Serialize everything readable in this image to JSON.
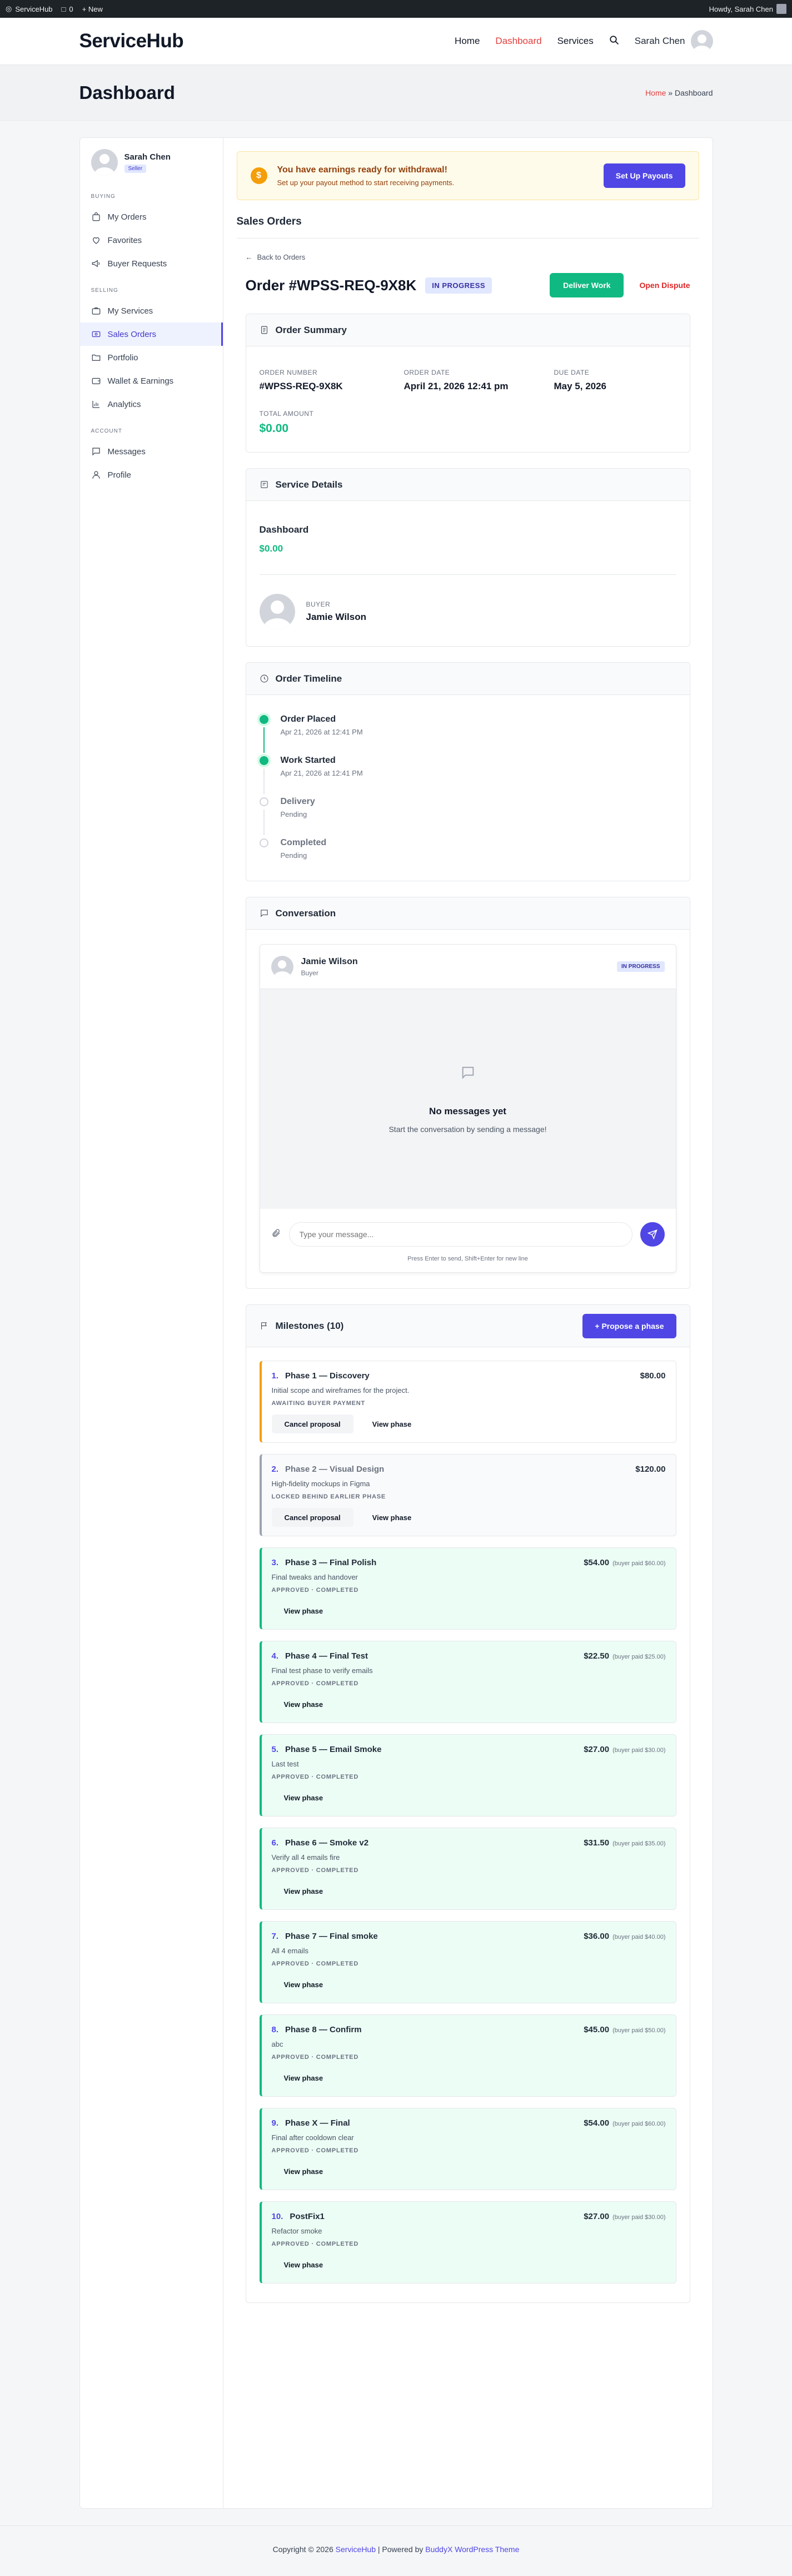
{
  "adminbar": {
    "site": "ServiceHub",
    "comments": "0",
    "new": "+ New",
    "howdy": "Howdy, Sarah Chen"
  },
  "header": {
    "logo": "ServiceHub",
    "nav": [
      "Home",
      "Dashboard",
      "Services"
    ],
    "user": "Sarah Chen"
  },
  "title_band": {
    "title": "Dashboard",
    "crumb_home": "Home",
    "crumb_sep": " » ",
    "crumb_current": "Dashboard"
  },
  "sidebar": {
    "name": "Sarah Chen",
    "role": "Seller",
    "buying_label": "BUYING",
    "buying": [
      "My Orders",
      "Favorites",
      "Buyer Requests"
    ],
    "selling_label": "SELLING",
    "selling": [
      "My Services",
      "Sales Orders",
      "Portfolio",
      "Wallet & Earnings",
      "Analytics"
    ],
    "account_label": "ACCOUNT",
    "account": [
      "Messages",
      "Profile"
    ]
  },
  "payout": {
    "title": "You have earnings ready for withdrawal!",
    "subtitle": "Set up your payout method to start receiving payments.",
    "button": "Set Up Payouts"
  },
  "section_title": "Sales Orders",
  "order": {
    "back": "Back to Orders",
    "number_title": "Order #WPSS-REQ-9X8K",
    "status": "IN PROGRESS",
    "deliver": "Deliver Work",
    "dispute": "Open Dispute"
  },
  "summary": {
    "title": "Order Summary",
    "order_number_label": "ORDER NUMBER",
    "order_number": "#WPSS-REQ-9X8K",
    "order_date_label": "ORDER DATE",
    "order_date": "April 21, 2026 12:41 pm",
    "due_date_label": "DUE DATE",
    "due_date": "May 5, 2026",
    "total_label": "TOTAL AMOUNT",
    "total": "$0.00"
  },
  "service": {
    "title": "Service Details",
    "name": "Dashboard",
    "price": "$0.00",
    "buyer_label": "BUYER",
    "buyer": "Jamie Wilson"
  },
  "timeline": {
    "title": "Order Timeline",
    "items": [
      {
        "title": "Order Placed",
        "sub": "Apr 21, 2026 at 12:41 PM"
      },
      {
        "title": "Work Started",
        "sub": "Apr 21, 2026 at 12:41 PM"
      },
      {
        "title": "Delivery",
        "sub": "Pending"
      },
      {
        "title": "Completed",
        "sub": "Pending"
      }
    ]
  },
  "conversation": {
    "title": "Conversation",
    "name": "Jamie Wilson",
    "role": "Buyer",
    "status": "IN PROGRESS",
    "empty_title": "No messages yet",
    "empty_sub": "Start the conversation by sending a message!",
    "placeholder": "Type your message...",
    "hint": "Press Enter to send, Shift+Enter for new line"
  },
  "milestones": {
    "title": "Milestones (10)",
    "propose": "+ Propose a phase",
    "items": [
      {
        "num": "1.",
        "title": "Phase 1 — Discovery",
        "amount": "$80.00",
        "paid": "",
        "desc": "Initial scope and wireframes for the project.",
        "status": "AWAITING BUYER PAYMENT",
        "btn1": "Cancel proposal",
        "btn2": "View phase"
      },
      {
        "num": "2.",
        "title": "Phase 2 — Visual Design",
        "amount": "$120.00",
        "paid": "",
        "desc": "High-fidelity mockups in Figma",
        "status": "LOCKED BEHIND EARLIER PHASE",
        "btn1": "Cancel proposal",
        "btn2": "View phase"
      },
      {
        "num": "3.",
        "title": "Phase 3 — Final Polish",
        "amount": "$54.00",
        "paid": "(buyer paid $60.00)",
        "desc": "Final tweaks and handover",
        "status": "APPROVED · COMPLETED",
        "btn2": "View phase"
      },
      {
        "num": "4.",
        "title": "Phase 4 — Final Test",
        "amount": "$22.50",
        "paid": "(buyer paid $25.00)",
        "desc": "Final test phase to verify emails",
        "status": "APPROVED · COMPLETED",
        "btn2": "View phase"
      },
      {
        "num": "5.",
        "title": "Phase 5 — Email Smoke",
        "amount": "$27.00",
        "paid": "(buyer paid $30.00)",
        "desc": "Last test",
        "status": "APPROVED · COMPLETED",
        "btn2": "View phase"
      },
      {
        "num": "6.",
        "title": "Phase 6 — Smoke v2",
        "amount": "$31.50",
        "paid": "(buyer paid $35.00)",
        "desc": "Verify all 4 emails fire",
        "status": "APPROVED · COMPLETED",
        "btn2": "View phase"
      },
      {
        "num": "7.",
        "title": "Phase 7 — Final smoke",
        "amount": "$36.00",
        "paid": "(buyer paid $40.00)",
        "desc": "All 4 emails",
        "status": "APPROVED · COMPLETED",
        "btn2": "View phase"
      },
      {
        "num": "8.",
        "title": "Phase 8 — Confirm",
        "amount": "$45.00",
        "paid": "(buyer paid $50.00)",
        "desc": "abc",
        "status": "APPROVED · COMPLETED",
        "btn2": "View phase"
      },
      {
        "num": "9.",
        "title": "Phase X — Final",
        "amount": "$54.00",
        "paid": "(buyer paid $60.00)",
        "desc": "Final after cooldown clear",
        "status": "APPROVED · COMPLETED",
        "btn2": "View phase"
      },
      {
        "num": "10.",
        "title": "PostFix1",
        "amount": "$27.00",
        "paid": "(buyer paid $30.00)",
        "desc": "Refactor smoke",
        "status": "APPROVED · COMPLETED",
        "btn2": "View phase"
      }
    ]
  },
  "footer": {
    "prefix": "Copyright © 2026 ",
    "brand": "ServiceHub",
    "mid": " | Powered by ",
    "theme": "BuddyX WordPress Theme"
  }
}
